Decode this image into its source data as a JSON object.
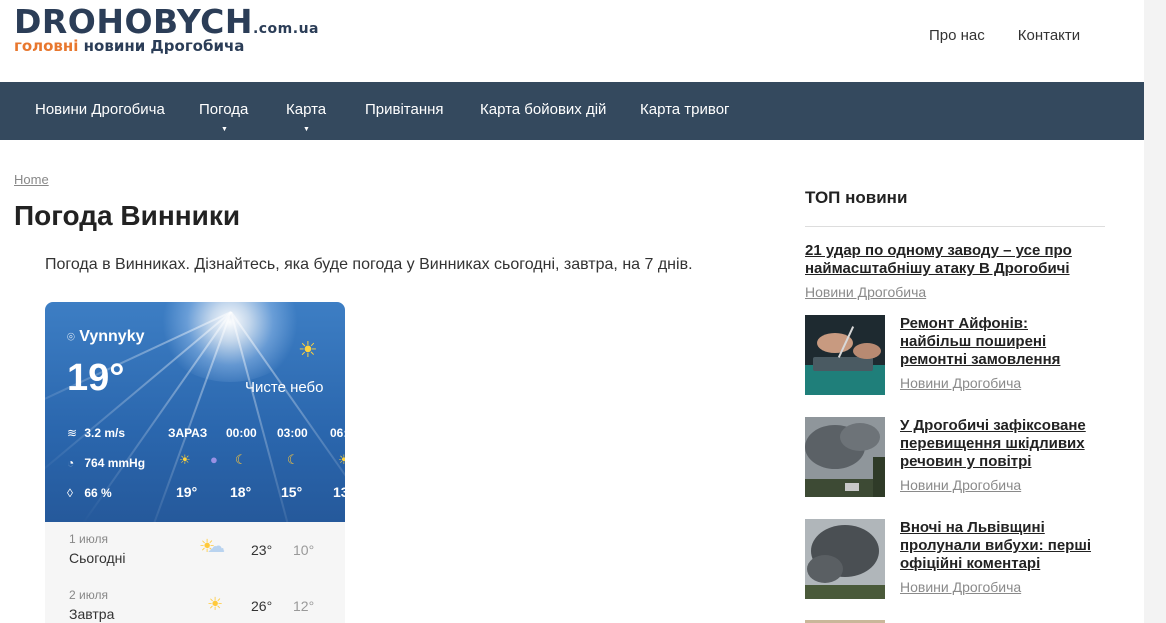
{
  "header": {
    "logo_main": "DROHOBYCH",
    "logo_domain": ".com.ua",
    "logo_tag_accent": "головні",
    "logo_tag_rest": " новини Дрогобича",
    "links": [
      "Про нас",
      "Контакти"
    ]
  },
  "nav": [
    {
      "label": "Новини Дрогобича",
      "dropdown": false
    },
    {
      "label": "Погода",
      "dropdown": true
    },
    {
      "label": "Карта",
      "dropdown": true
    },
    {
      "label": "Привітання",
      "dropdown": false
    },
    {
      "label": "Карта бойових дій",
      "dropdown": false
    },
    {
      "label": "Карта тривог",
      "dropdown": false
    }
  ],
  "breadcrumb": "Home",
  "page_title": "Погода Винники",
  "intro": "Погода в Винниках. Дізнайтесь, яка буде погода у Винниках сьогодні, завтра, на 7 днів.",
  "weather": {
    "location": "Vynnyky",
    "temperature": "19°",
    "condition": "Чисте небо",
    "wind": "3.2 m/s",
    "pressure": "764 mmHg",
    "humidity": "66 %",
    "hours": [
      {
        "label": "ЗАРАЗ",
        "icon": "sun-icon",
        "temp": "19°"
      },
      {
        "label": "00:00",
        "icon": "moon-icon",
        "temp": "18°"
      },
      {
        "label": "03:00",
        "icon": "moon-icon",
        "temp": "15°"
      },
      {
        "label": "06:",
        "icon": "sun-icon",
        "temp": "13"
      }
    ],
    "days": [
      {
        "date": "1 июля",
        "name": "Сьогодні",
        "icon": "partly-cloudy-icon",
        "high": "23°",
        "low": "10°"
      },
      {
        "date": "2 июля",
        "name": "Завтра",
        "icon": "sun-icon",
        "high": "26°",
        "low": "12°"
      }
    ]
  },
  "sidebar": {
    "heading": "ТОП новини",
    "items": [
      {
        "title": "21 удар по одному заводу – усе про наймасштабнішу атаку В Дрогобичі",
        "category": "Новини Дрогобича"
      },
      {
        "title": "Ремонт Айфонів: найбільш поширені ремонтні замовлення",
        "category": "Новини Дрогобича"
      },
      {
        "title": "У Дрогобичі зафіксоване перевищення шкідливих речовин у повітрі",
        "category": "Новини Дрогобича"
      },
      {
        "title": "Вночі на Львівщині пролунали вибухи: перші офіційні коментарі",
        "category": "Новини Дрогобича"
      }
    ]
  },
  "colors": {
    "nav_bg": "#34495e",
    "logo": "#2b3d57",
    "accent": "#e8772e"
  }
}
